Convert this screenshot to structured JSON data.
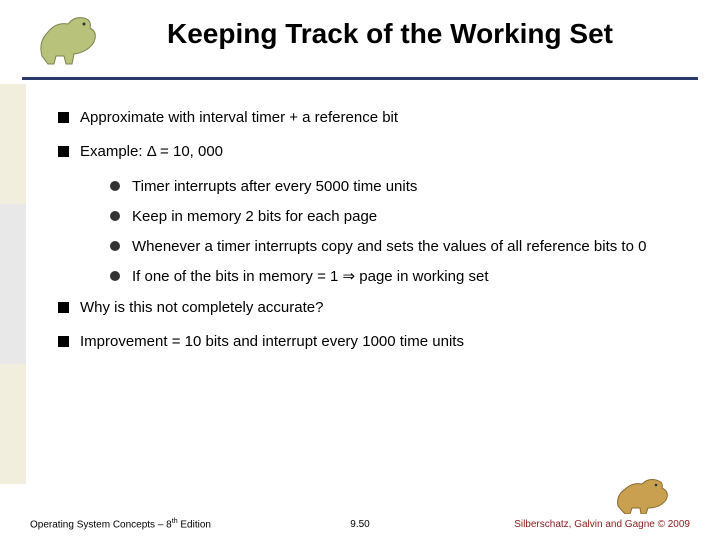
{
  "title": "Keeping Track of the Working Set",
  "bullets": {
    "b1": "Approximate with interval timer + a reference bit",
    "b2": "Example: Δ = 10, 000",
    "b2a": "Timer interrupts after every 5000 time units",
    "b2b": "Keep in memory 2 bits for each page",
    "b2c": "Whenever a timer interrupts copy and sets the values of all reference bits to 0",
    "b2d": "If one of the bits in memory = 1 ⇒ page in working set",
    "b3": "Why is this not completely accurate?",
    "b4": "Improvement = 10 bits and interrupt every 1000 time units"
  },
  "footer": {
    "left_a": "Operating System Concepts – 8",
    "left_b": " Edition",
    "left_sup": "th",
    "center": "9.50",
    "right": "Silberschatz, Galvin and Gagne © 2009"
  },
  "icons": {
    "dino_top": "dinosaur-icon",
    "dino_bottom": "dinosaur-icon"
  }
}
